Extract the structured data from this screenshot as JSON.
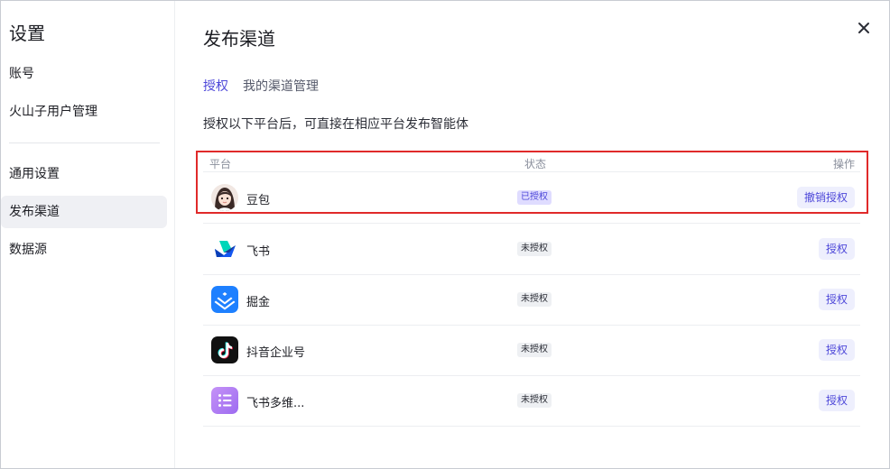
{
  "sidebar": {
    "title": "设置",
    "items": [
      {
        "label": "账号"
      },
      {
        "label": "火山子用户管理"
      },
      {
        "label": "通用设置"
      },
      {
        "label": "发布渠道"
      },
      {
        "label": "数据源"
      }
    ]
  },
  "main": {
    "title": "发布渠道",
    "tabs": [
      {
        "label": "授权",
        "active": true
      },
      {
        "label": "我的渠道管理",
        "active": false
      }
    ],
    "description": "授权以下平台后，可直接在相应平台发布智能体",
    "table": {
      "headers": {
        "platform": "平台",
        "status": "状态",
        "action": "操作"
      },
      "rows": [
        {
          "name": "豆包",
          "status": "已授权",
          "action": "撤销授权",
          "icon": "doubao-avatar-icon"
        },
        {
          "name": "飞书",
          "status": "未授权",
          "action": "授权",
          "icon": "feishu-logo-icon"
        },
        {
          "name": "掘金",
          "status": "未授权",
          "action": "授权",
          "icon": "juejin-logo-icon"
        },
        {
          "name": "抖音企业号",
          "status": "未授权",
          "action": "授权",
          "icon": "douyin-logo-icon"
        },
        {
          "name": "飞书多维...",
          "status": "未授权",
          "action": "授权",
          "icon": "feishu-bitable-logo-icon"
        }
      ]
    }
  },
  "colors": {
    "accent": "#4e48d9",
    "highlight_border": "#e02a2a",
    "active_sidebar_bg": "#eff0f4"
  }
}
